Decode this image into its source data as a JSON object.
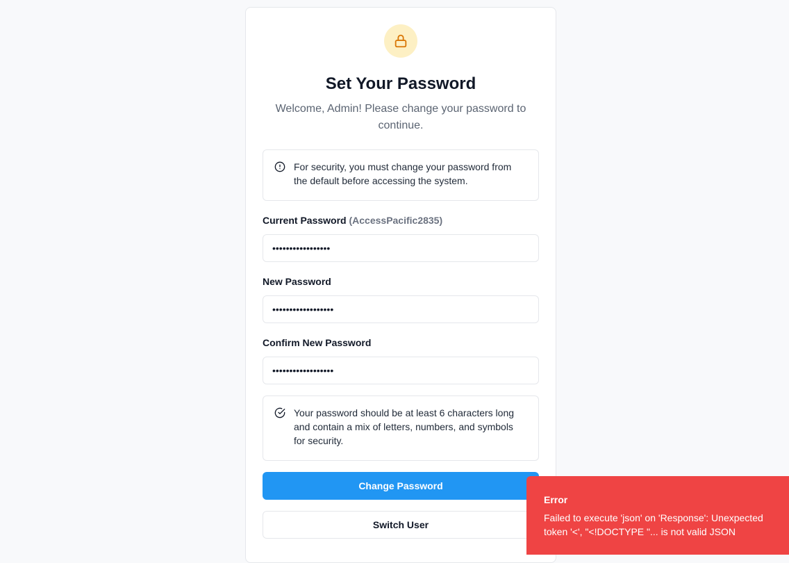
{
  "page": {
    "title": "Set Your Password",
    "subtitle": "Welcome, Admin! Please change your password to continue."
  },
  "security_notice": {
    "icon": "alert-circle-icon",
    "text": "For security, you must change your password from the default before accessing the system."
  },
  "form": {
    "current_password": {
      "label": "Current Password",
      "hint": "(AccessPacific2835)",
      "masked_value": "•••••••••••••••••"
    },
    "new_password": {
      "label": "New Password",
      "masked_value": "••••••••••••••••••"
    },
    "confirm_password": {
      "label": "Confirm New Password",
      "masked_value": "••••••••••••••••••"
    }
  },
  "password_rule": {
    "icon": "check-circle-icon",
    "text": "Your password should be at least 6 characters long and contain a mix of letters, numbers, and symbols for security."
  },
  "buttons": {
    "change_password": "Change Password",
    "switch_user": "Switch User"
  },
  "toast": {
    "title": "Error",
    "message": "Failed to execute 'json' on 'Response': Unexpected token '<', \"<!DOCTYPE \"... is not valid JSON"
  },
  "colors": {
    "primary": "#2196f3",
    "error": "#ef4444",
    "lock_bg": "#fdf0c4",
    "lock_icon": "#d97706"
  },
  "icons": {
    "header": "lock-icon"
  }
}
